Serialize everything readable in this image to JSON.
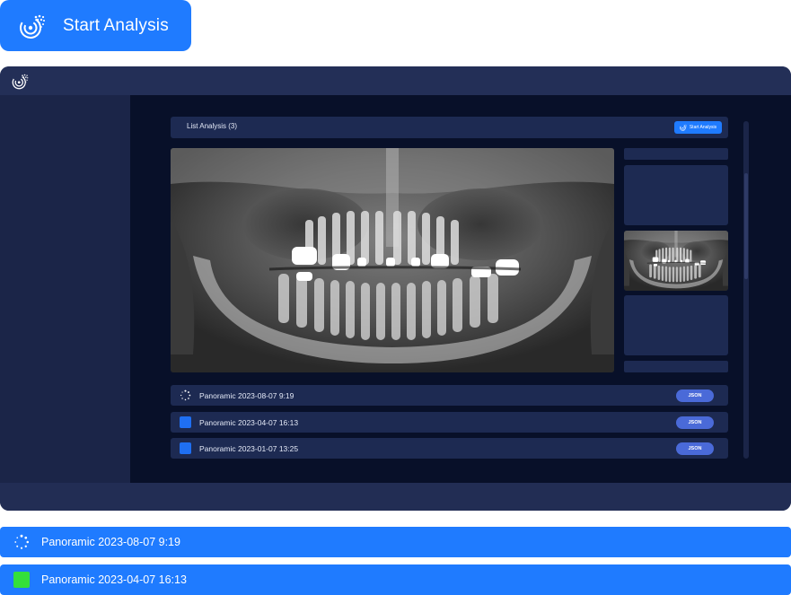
{
  "cta": {
    "label": "Start Analysis"
  },
  "app": {
    "header": {
      "title": "List Analysis (3)",
      "button_label": "Start Analysis"
    },
    "analyses": [
      {
        "name": "Panoramic 2023-08-07 9:19",
        "status": "loading",
        "action": "JSON"
      },
      {
        "name": "Panoramic 2023-04-07 16:13",
        "status": "done",
        "action": "JSON"
      },
      {
        "name": "Panoramic 2023-01-07 13:25",
        "status": "done",
        "action": "JSON"
      }
    ]
  },
  "highlights": [
    {
      "name": "Panoramic 2023-08-07 9:19",
      "status": "loading"
    },
    {
      "name": "Panoramic 2023-04-07 16:13",
      "status": "complete"
    }
  ],
  "icons": {
    "logo": "analysis-logo-icon",
    "loading": "loading-spinner-icon"
  },
  "colors": {
    "accent": "#1f7bff",
    "window_bg": "#222d54",
    "main_bg": "#081029",
    "panel_bg": "#1d2a52",
    "json_button": "#4a6ad8",
    "status_done": "#1f6ff2",
    "status_complete": "#34e03a"
  }
}
